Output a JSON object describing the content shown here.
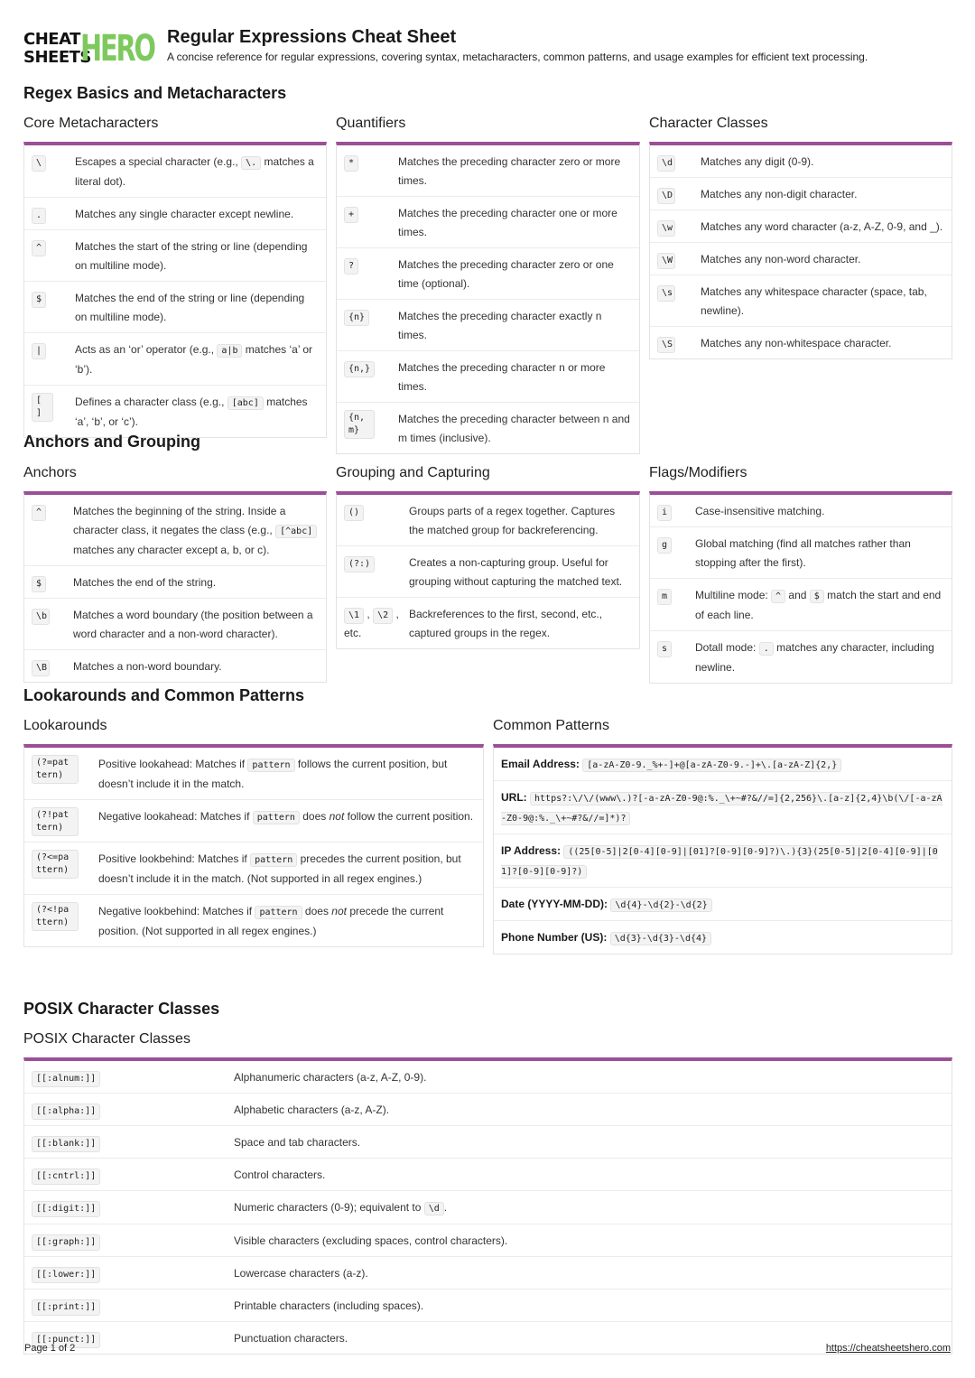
{
  "header": {
    "logo_line1": "CHEAT",
    "logo_line2": "SHEETS",
    "logo_hero": "HERO",
    "title": "Regular Expressions Cheat Sheet",
    "subtitle": "A concise reference for regular expressions, covering syntax, metacharacters, common patterns, and usage examples for efficient text processing."
  },
  "sections": {
    "basics": "Regex Basics and Metacharacters",
    "anchors": "Anchors and Grouping",
    "lookarounds": "Lookarounds and Common Patterns",
    "posix": "POSIX Character Classes"
  },
  "core_meta": {
    "title": "Core Metacharacters",
    "rows": [
      {
        "k": "\\",
        "pre": "Escapes a special character (e.g., ",
        "code": "\\.",
        "post": " matches a literal dot)."
      },
      {
        "k": ".",
        "pre": "Matches any single character except newline.",
        "code": "",
        "post": ""
      },
      {
        "k": "^",
        "pre": "Matches the start of the string or line (depending on multiline mode).",
        "code": "",
        "post": ""
      },
      {
        "k": "$",
        "pre": "Matches the end of the string or line (depending on multiline mode).",
        "code": "",
        "post": ""
      },
      {
        "k": "|",
        "pre": "Acts as an ‘or’ operator (e.g., ",
        "code": "a|b",
        "post": " matches ‘a’ or ‘b’)."
      },
      {
        "k": "[ ]",
        "pre": "Defines a character class (e.g., ",
        "code": "[abc]",
        "post": " matches ‘a’, ‘b’, or ‘c’)."
      }
    ]
  },
  "quantifiers": {
    "title": "Quantifiers",
    "rows": [
      {
        "k": "*",
        "v": "Matches the preceding character zero or more times."
      },
      {
        "k": "+",
        "v": "Matches the preceding character one or more times."
      },
      {
        "k": "?",
        "v": "Matches the preceding character zero or one time (optional)."
      },
      {
        "k": "{n}",
        "v": "Matches the preceding character exactly n times."
      },
      {
        "k": "{n,}",
        "v": "Matches the preceding character n or more times."
      },
      {
        "k": "{n,m}",
        "v": "Matches the preceding character between n and m times (inclusive)."
      }
    ]
  },
  "char_classes": {
    "title": "Character Classes",
    "rows": [
      {
        "k": "\\d",
        "v": "Matches any digit (0-9)."
      },
      {
        "k": "\\D",
        "v": "Matches any non-digit character."
      },
      {
        "k": "\\w",
        "v": "Matches any word character (a-z, A-Z, 0-9, and _)."
      },
      {
        "k": "\\W",
        "v": "Matches any non-word character."
      },
      {
        "k": "\\s",
        "v": "Matches any whitespace character (space, tab, newline)."
      },
      {
        "k": "\\S",
        "v": "Matches any non-whitespace character."
      }
    ]
  },
  "anchors": {
    "title": "Anchors",
    "rows": [
      {
        "k": "^",
        "pre": "Matches the beginning of the string. Inside a character class, it negates the class (e.g., ",
        "code": "[^abc]",
        "post": " matches any character except a, b, or c)."
      },
      {
        "k": "$",
        "pre": "Matches the end of the string.",
        "code": "",
        "post": ""
      },
      {
        "k": "\\b",
        "pre": "Matches a word boundary (the position between a word character and a non-word character).",
        "code": "",
        "post": ""
      },
      {
        "k": "\\B",
        "pre": "Matches a non-word boundary.",
        "code": "",
        "post": ""
      }
    ]
  },
  "grouping": {
    "title": "Grouping and Capturing",
    "rows": [
      {
        "k": "()",
        "v": "Groups parts of a regex together. Captures the matched group for backreferencing."
      },
      {
        "k": "(?:)",
        "v": "Creates a non-capturing group. Useful for grouping without capturing the matched text."
      },
      {
        "k": "\\1",
        "k2": "\\2",
        "k3": "etc.",
        "v": "Backreferences to the first, second, etc., captured groups in the regex."
      }
    ]
  },
  "flags": {
    "title": "Flags/Modifiers",
    "rows": [
      {
        "k": "i",
        "v": "Case-insensitive matching."
      },
      {
        "k": "g",
        "v": "Global matching (find all matches rather than stopping after the first)."
      },
      {
        "k": "m",
        "v1": "Multiline mode: ",
        "c1": "^",
        "v2": " and ",
        "c2": "$",
        "v3": " match the start and end of each line."
      },
      {
        "k": "s",
        "v1": "Dotall mode: ",
        "c1": ".",
        "v2": " matches any character, including newline."
      }
    ]
  },
  "lookarounds": {
    "title": "Lookarounds",
    "rows": [
      {
        "k": "(?=pattern)",
        "pre": "Positive lookahead: Matches if ",
        "code": "pattern",
        "mid": " follows the current position, but doesn’t include it in the match.",
        "em": "",
        "post": ""
      },
      {
        "k": "(?!pattern)",
        "pre": "Negative lookahead: Matches if ",
        "code": "pattern",
        "mid": " does ",
        "em": "not",
        "post": " follow the current position."
      },
      {
        "k": "(?<=pattern)",
        "pre": "Positive lookbehind: Matches if ",
        "code": "pattern",
        "mid": " precedes the current position, but doesn’t include it in the match. (Not supported in all regex engines.)",
        "em": "",
        "post": ""
      },
      {
        "k": "(?<!pattern)",
        "pre": "Negative lookbehind: Matches if ",
        "code": "pattern",
        "mid": " does ",
        "em": "not",
        "post": " precede the current position. (Not supported in all regex engines.)"
      }
    ]
  },
  "common_patterns": {
    "title": "Common Patterns",
    "rows": [
      {
        "label": "Email Address:",
        "code": "[a-zA-Z0-9._%+-]+@[a-zA-Z0-9.-]+\\.[a-zA-Z]{2,}"
      },
      {
        "label": "URL:",
        "code": "https?:\\/\\/(www\\.)?[-a-zA-Z0-9@:%._\\+~#?&//=]{2,256}\\.[a-z]{2,4}\\b(\\/[-a-zA-Z0-9@:%._\\+~#?&//=]*)?"
      },
      {
        "label": "IP Address:",
        "code": "((25[0-5]|2[0-4][0-9]|[01]?[0-9][0-9]?)\\.){3}(25[0-5]|2[0-4][0-9]|[01]?[0-9][0-9]?)"
      },
      {
        "label": "Date (YYYY-MM-DD):",
        "code": "\\d{4}-\\d{2}-\\d{2}"
      },
      {
        "label": "Phone Number (US):",
        "code": "\\d{3}-\\d{3}-\\d{4}"
      }
    ]
  },
  "posix": {
    "title": "POSIX Character Classes",
    "rows": [
      {
        "k": "[[:alnum:]]",
        "v": "Alphanumeric characters (a-z, A-Z, 0-9).",
        "code": "",
        "post": ""
      },
      {
        "k": "[[:alpha:]]",
        "v": "Alphabetic characters (a-z, A-Z).",
        "code": "",
        "post": ""
      },
      {
        "k": "[[:blank:]]",
        "v": "Space and tab characters.",
        "code": "",
        "post": ""
      },
      {
        "k": "[[:cntrl:]]",
        "v": "Control characters.",
        "code": "",
        "post": ""
      },
      {
        "k": "[[:digit:]]",
        "v": "Numeric characters (0-9); equivalent to ",
        "code": "\\d",
        "post": "."
      },
      {
        "k": "[[:graph:]]",
        "v": "Visible characters (excluding spaces, control characters).",
        "code": "",
        "post": ""
      },
      {
        "k": "[[:lower:]]",
        "v": "Lowercase characters (a-z).",
        "code": "",
        "post": ""
      },
      {
        "k": "[[:print:]]",
        "v": "Printable characters (including spaces).",
        "code": "",
        "post": ""
      },
      {
        "k": "[[:punct:]]",
        "v": "Punctuation characters.",
        "code": "",
        "post": ""
      }
    ]
  },
  "footer": {
    "page": "Page 1 of 2",
    "link": "https://cheatsheetshero.com"
  },
  "colors": {
    "accent_border": "#9b4f96",
    "logo_green": "#7dc95e"
  }
}
